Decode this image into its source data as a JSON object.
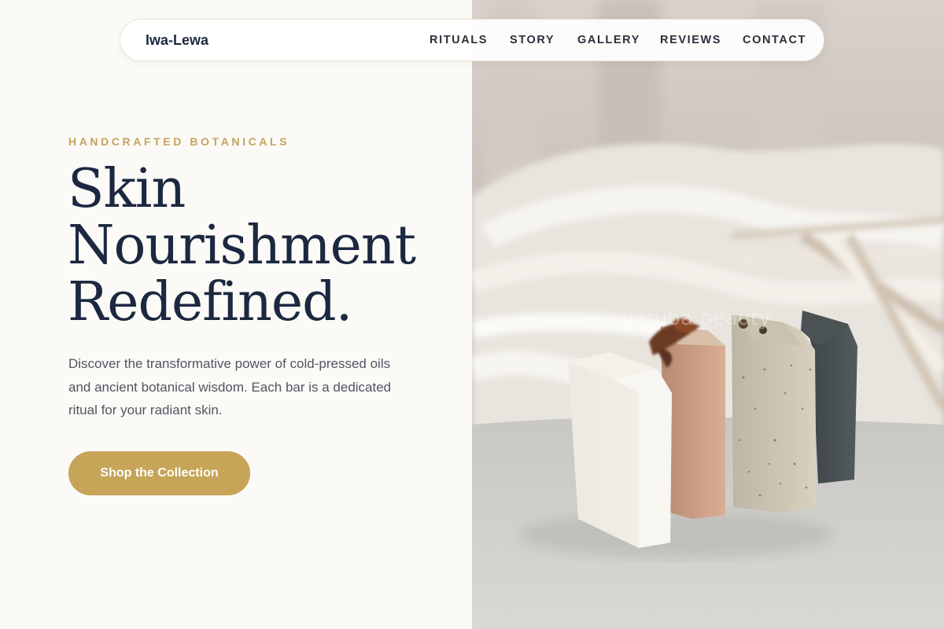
{
  "nav": {
    "brand": "Iwa-Lewa",
    "links": [
      "RITUALS",
      "STORY",
      "GALLERY",
      "REVIEWS",
      "CONTACT"
    ]
  },
  "hero": {
    "eyebrow": "HANDCRAFTED BOTANICALS",
    "headline_lines": [
      "Skin",
      "Nourishment",
      "Redefined."
    ],
    "description": "Discover the transformative power of cold-pressed oils and ancient botanical wisdom. Each bar is a dedicated ritual for your radiant skin.",
    "cta_label": "Shop the Collection"
  },
  "image": {
    "subject": "handmade soap bars on linen",
    "watermark": "yoruba beauty"
  },
  "colors": {
    "accent_gold": "#c6a458",
    "heading_navy": "#1c2840",
    "background_cream": "#fbfaf7",
    "body_gray": "#4f5561"
  }
}
